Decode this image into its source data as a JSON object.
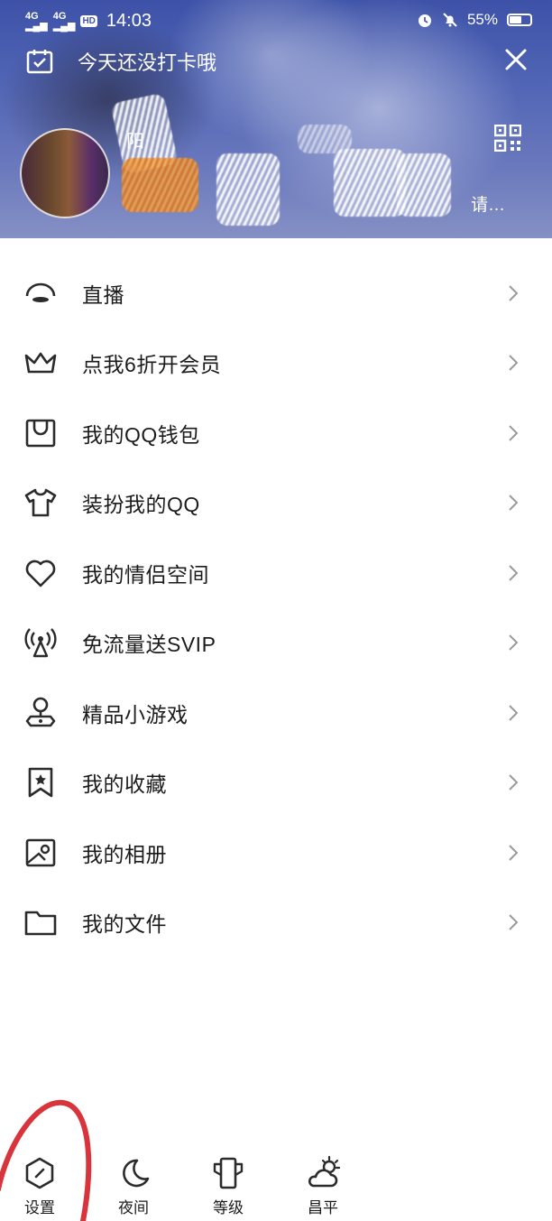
{
  "status_bar": {
    "signal1": "4G",
    "signal2": "4G",
    "hd": "HD",
    "time": "14:03",
    "battery": "55%"
  },
  "header": {
    "checkin_text": "今天还没打卡哦",
    "nickname": "阳",
    "signature": "请…"
  },
  "menu": [
    {
      "label": "直播",
      "icon": "live-icon"
    },
    {
      "label": "点我6折开会员",
      "icon": "crown-icon"
    },
    {
      "label": "我的QQ钱包",
      "icon": "wallet-icon"
    },
    {
      "label": "装扮我的QQ",
      "icon": "tshirt-icon"
    },
    {
      "label": "我的情侣空间",
      "icon": "heart-icon"
    },
    {
      "label": "免流量送SVIP",
      "icon": "signal-tower-icon"
    },
    {
      "label": "精品小游戏",
      "icon": "game-pin-icon"
    },
    {
      "label": "我的收藏",
      "icon": "bookmark-star-icon"
    },
    {
      "label": "我的相册",
      "icon": "photo-icon"
    },
    {
      "label": "我的文件",
      "icon": "folder-icon"
    }
  ],
  "bottom_bar": {
    "settings": "设置",
    "night": "夜间",
    "level": "等级",
    "weather": "昌平"
  },
  "colors": {
    "banner": "#4b5fae",
    "annotation": "#d9343c"
  }
}
